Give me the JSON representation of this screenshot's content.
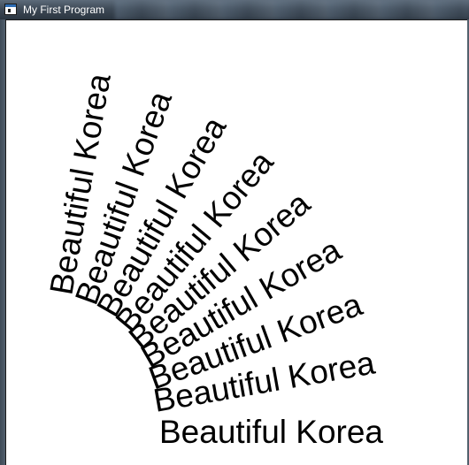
{
  "window": {
    "title": "My First Program"
  },
  "canvas": {
    "text": "Beautiful Korea",
    "text_color": "#000000",
    "repeat_count": 9,
    "rotation_degrees": [
      -80,
      -70,
      -60,
      -50,
      -40,
      -30,
      -20,
      -10,
      0
    ]
  }
}
